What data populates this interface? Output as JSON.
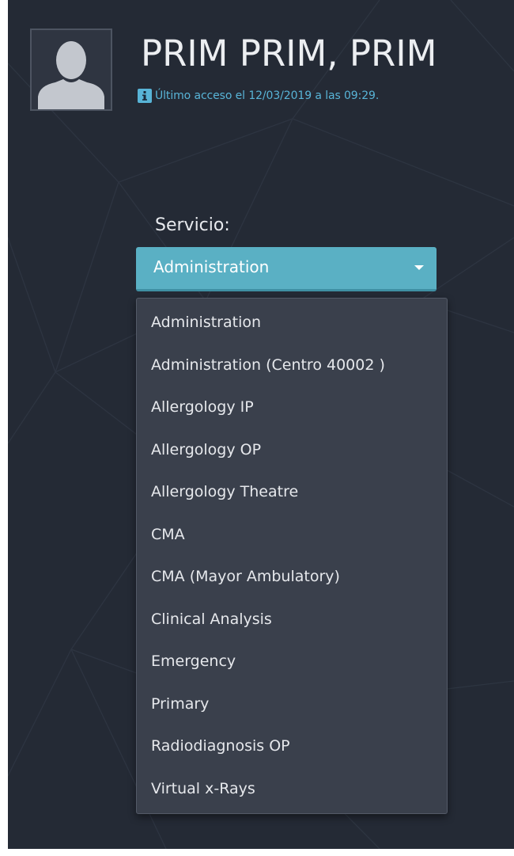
{
  "user": {
    "name": "PRIM PRIM, PRIM",
    "last_access": "Último acceso el 12/03/2019 a las 09:29."
  },
  "service": {
    "label": "Servicio:",
    "selected": "Administration",
    "options": [
      "Administration",
      "Administration (Centro 40002 )",
      "Allergology IP",
      "Allergology OP",
      "Allergology Theatre",
      "CMA",
      "CMA (Mayor Ambulatory)",
      "Clinical Analysis",
      "Emergency",
      "Primary",
      "Radiodiagnosis OP",
      "Virtual x-Rays"
    ]
  },
  "icons": {
    "avatar": "user-silhouette",
    "info": "info-i",
    "caret": "caret-down"
  },
  "colors": {
    "background": "#242a35",
    "accent": "#5ab0c4",
    "info": "#58b4d7",
    "menu_bg": "#3a404c"
  }
}
